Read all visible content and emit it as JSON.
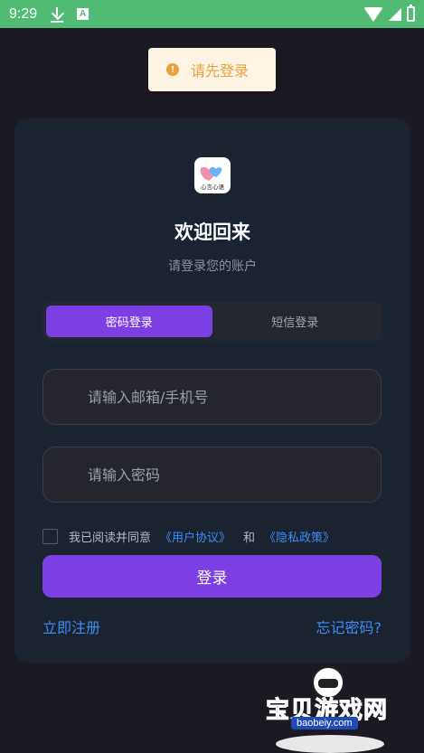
{
  "status_bar": {
    "time": "9:29",
    "notification_icons": [
      "download-icon",
      "a-icon"
    ],
    "system_icons": [
      "wifi-icon",
      "signal-icon",
      "battery-icon"
    ],
    "background_color": "#52bb73"
  },
  "toast": {
    "icon": "warning-icon",
    "message": "请先登录",
    "color": "#e6a23c"
  },
  "login_card": {
    "logo_text": "心言心语",
    "title": "欢迎回来",
    "subtitle": "请登录您的账户",
    "tabs": [
      {
        "label": "密码登录",
        "active": true
      },
      {
        "label": "短信登录",
        "active": false
      }
    ],
    "account_field": {
      "value": "",
      "placeholder": "请输入邮箱/手机号"
    },
    "password_field": {
      "value": "",
      "placeholder": "请输入密码"
    },
    "agreement": {
      "checked": false,
      "prefix": "我已阅读并同意",
      "user_agreement": "《用户协议》",
      "and": "和",
      "privacy_policy": "《隐私政策》"
    },
    "login_button": "登录",
    "register_link": "立即注册",
    "forgot_link": "忘记密码?"
  },
  "watermark": {
    "name": "宝贝游戏网",
    "url": "baobeiy.com"
  },
  "colors": {
    "background": "#1b1a22",
    "card": "#1b2230",
    "accent": "#7b3fe4",
    "link": "#3a8ef6"
  }
}
